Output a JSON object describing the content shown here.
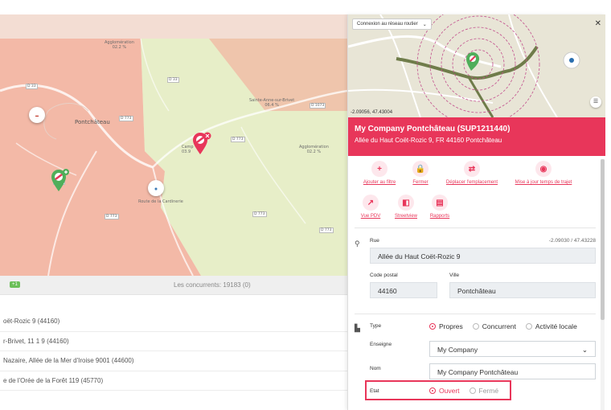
{
  "map": {
    "labels": {
      "agglo_top": "Agglomération",
      "agglo_top_pct": "02.2 %",
      "sainte_anne": "Sainte-Anne-sur-Brivet",
      "sainte_anne_pct": "06.4 %",
      "agglo_right": "Agglomération",
      "agglo_right_pct": "02.2 %",
      "pontchateau": "Pontchâteau",
      "campbon": "Camp",
      "campbon_pct": "03.9",
      "carrefour": "Route de la Cardinerie"
    },
    "road_tags": [
      "D 33",
      "D 33",
      "D 773",
      "D 773",
      "D 33",
      "D 773",
      "D 1073",
      "D 773",
      "D 773"
    ]
  },
  "list": {
    "tag": "+1",
    "competitors_label": "Les concurrents: 19183 (0)",
    "rows": [
      "oët-Rozic 9 (44160)",
      "r-Brivet, 11 1 9 (44160)",
      "Nazaire, Allée de la Mer d'Iroise 9001 (44600)",
      "e de l'Orée de la Forêt 119 (45770)"
    ]
  },
  "panel": {
    "network_select": "Connexion au réseau routier",
    "coords_mini": "-2.09056, 47.43004",
    "banner": {
      "title": "My Company Pontchâteau (SUP1211440)",
      "address": "Allée du Haut Coët-Rozic 9, FR 44160 Pontchâteau"
    },
    "actions": [
      {
        "label": "Ajouter au filtre",
        "icon": "+"
      },
      {
        "label": "Fermer",
        "icon": "🔒"
      },
      {
        "label": "Déplacer l'emplacement",
        "icon": "⇄"
      },
      {
        "label": "Mise à jour temps de trajet",
        "icon": "◉"
      },
      {
        "label": "Vue PDV",
        "icon": "↗"
      },
      {
        "label": "Streetview",
        "icon": "◧"
      },
      {
        "label": "Rapports",
        "icon": "▤"
      }
    ],
    "rue_label": "Rue",
    "coords": "-2.09030 / 47.43228",
    "rue_value": "Allée du Haut Coët-Rozic 9",
    "cp_label": "Code postal",
    "cp_value": "44160",
    "ville_label": "Ville",
    "ville_value": "Pontchâteau",
    "type_label": "Type",
    "type_options": [
      "Propres",
      "Concurrent",
      "Activité locale"
    ],
    "type_selected": "Propres",
    "enseigne_label": "Enseigne",
    "enseigne_value": "My Company",
    "nom_label": "Nom",
    "nom_value": "My Company Pontchâteau",
    "etat_label": "Etat",
    "etat_options": [
      "Ouvert",
      "Fermé"
    ],
    "etat_selected": "Ouvert"
  },
  "colors": {
    "accent": "#e8365a",
    "map_red": "#f2a38b",
    "map_green": "#e3edbf",
    "tag_green": "#6bbf59"
  }
}
